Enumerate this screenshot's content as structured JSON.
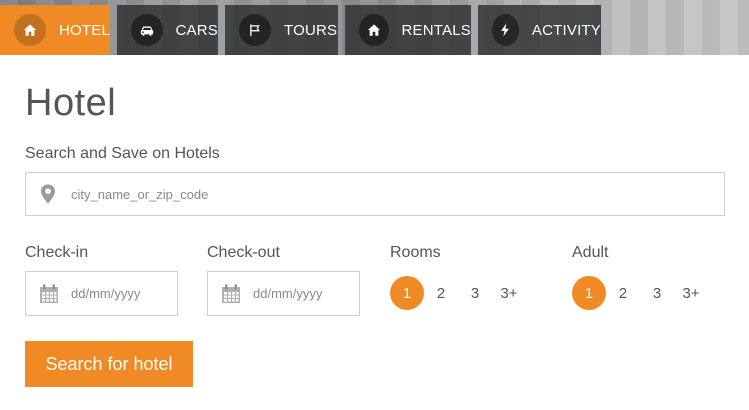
{
  "tabs": [
    {
      "label": "HOTEL",
      "icon": "home-icon",
      "active": true
    },
    {
      "label": "CARS",
      "icon": "car-icon",
      "active": false
    },
    {
      "label": "TOURS",
      "icon": "flag-icon",
      "active": false
    },
    {
      "label": "RENTALS",
      "icon": "home-icon",
      "active": false
    },
    {
      "label": "ACTIVITY",
      "icon": "bolt-icon",
      "active": false
    }
  ],
  "colors": {
    "accent": "#f08a24",
    "tab_bg": "#303030",
    "text": "#555555",
    "border": "#cfcfcf"
  },
  "form": {
    "title": "Hotel",
    "subtitle": "Search and Save on Hotels",
    "search_placeholder": "city_name_or_zip_code",
    "checkin_label": "Check-in",
    "checkout_label": "Check-out",
    "date_placeholder": "dd/mm/yyyy",
    "rooms_label": "Rooms",
    "adult_label": "Adult",
    "rooms_options": [
      "1",
      "2",
      "3",
      "3+"
    ],
    "rooms_selected": "1",
    "adult_options": [
      "1",
      "2",
      "3",
      "3+"
    ],
    "adult_selected": "1",
    "submit_label": "Search for hotel"
  }
}
